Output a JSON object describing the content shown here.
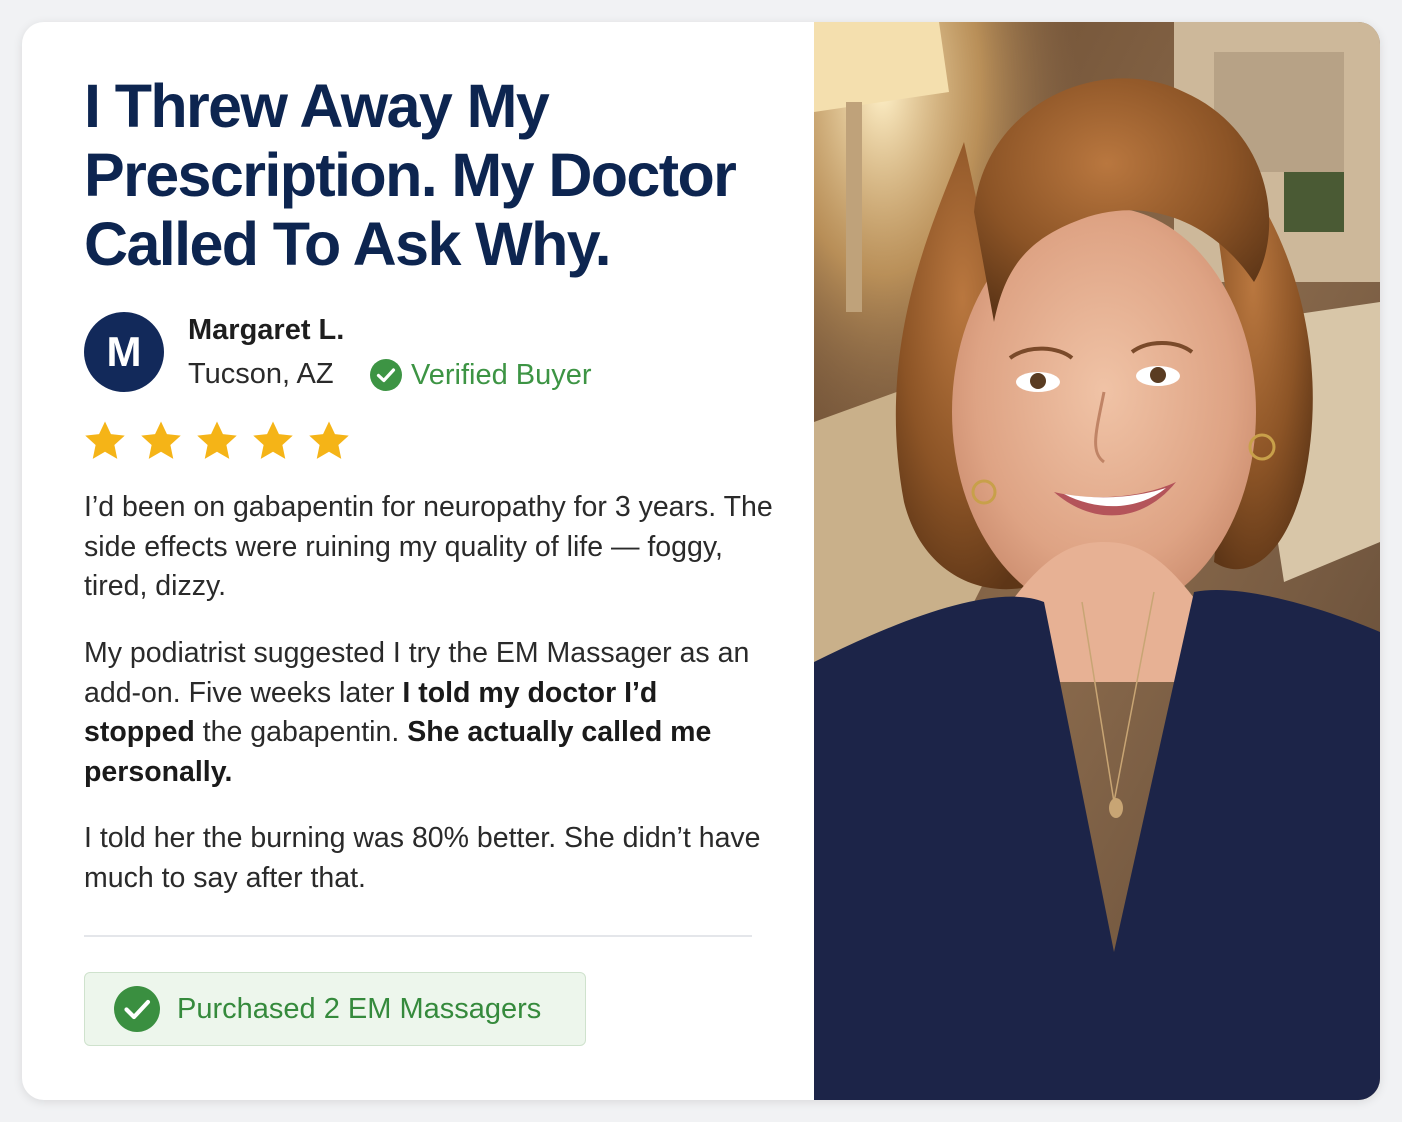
{
  "review": {
    "headline": "I Threw Away My Prescription. My Doctor Called To Ask Why.",
    "reviewer": {
      "initial": "M",
      "name": "Margaret L.",
      "location": "Tucson, AZ",
      "verified_label": "Verified Buyer"
    },
    "rating": 5,
    "paragraphs": {
      "p1": "I’d been on gabapentin for neuropathy for 3 years. The side effects were ruining my quality of life — foggy, tired, dizzy.",
      "p2_a": "My podiatrist suggested I try the EM Massager as an add-on. Five weeks later ",
      "p2_b": "I told my doctor I’d stopped",
      "p2_c": " the gabapentin. ",
      "p2_d": "She actually called me personally.",
      "p3": "I told her the burning was 80% better. She didn’t have much to say after that."
    },
    "purchase_label": "Purchased 2 EM Massagers"
  },
  "colors": {
    "headline": "#0d2550",
    "avatar": "#12295a",
    "star": "#f5b417",
    "verified_green": "#3d9444",
    "purchase_bg": "#edf6ec"
  },
  "icons": {
    "verified": "check-circle-icon",
    "rating": "star-icon",
    "purchase": "check-circle-icon"
  }
}
